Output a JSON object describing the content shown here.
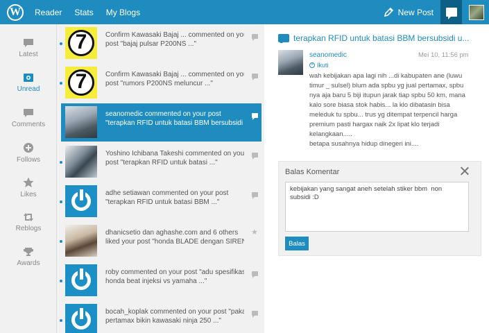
{
  "topbar": {
    "logo": "W",
    "nav": [
      "Reader",
      "Stats",
      "My Blogs"
    ],
    "new_post": "New Post"
  },
  "leftnav": {
    "items": [
      {
        "label": "Latest",
        "icon": "comment-bubble-icon"
      },
      {
        "label": "Unread",
        "icon": "unread-icon",
        "active": true
      },
      {
        "label": "Comments",
        "icon": "comment-bubble-icon"
      },
      {
        "label": "Follows",
        "icon": "plus-circle-icon"
      },
      {
        "label": "Likes",
        "icon": "star-icon"
      },
      {
        "label": "Reblogs",
        "icon": "reblog-icon"
      },
      {
        "label": "Awards",
        "icon": "trophy-icon"
      }
    ]
  },
  "notifications": [
    {
      "line1": "Confirm Kawasaki Bajaj ... commented on your",
      "line2": "post \"bajaj pulsar P200NS ...\"",
      "thumb": "kawasaki-logo"
    },
    {
      "line1": "Confirm Kawasaki Bajaj ... commented on your",
      "line2": "post \"rumors P200NS meluncur ...\"",
      "thumb": "kawasaki-logo"
    },
    {
      "line1": "seanomedic commented on your post",
      "line2": "\"terapkan RFID untuk batasi BBM bersubsidi",
      "thumb": "photo",
      "selected": true
    },
    {
      "line1": "Yoshino Ichibana Takeshi commented on your",
      "line2": "post \"terapkan RFID untuk batasi ...\"",
      "thumb": "photo"
    },
    {
      "line1": "adhe setiawan commented on your post",
      "line2": "\"terapkan RFID untuk batasi BBM ...\"",
      "thumb": "gravatar"
    },
    {
      "line1": "dhanicsetio dan aghashe.com and 6 others",
      "line2": "liked your post \"honda BLADE dengan SIREN",
      "thumb": "photo",
      "star": true
    },
    {
      "line1": "roby commented on your post \"adu spesifikasi",
      "line2": "honda beat injeksi vs yamaha ...\"",
      "thumb": "gravatar"
    },
    {
      "line1": "bocah_koplak commented on your post \"pakai",
      "line2": "pertamax bikin kawasaki ninja 250 ...\"",
      "thumb": "gravatar"
    }
  ],
  "detail": {
    "title": "terapkan RFID untuk batasi BBM bersubsidi u...",
    "author": "seanomedic",
    "follow": "Ikuti",
    "date": "Mei 10, 11:56 pm",
    "body_lines": [
      "wah kebijakan apa lagi nih ...di kabupaten ane (luwu",
      "timur _ sulsel) blum ada spbu yg jual pertamax, spbu",
      "nya aja baru 5 biji itupun jarak tiap spbu 50 km, mana",
      "kalo sore biasa stok habis... la klo dibatasin bisa",
      "meleduk tu spbu... trus yg ditempat terpencil harga",
      "premium pasti hargax naik 2x lipat klo terjadi",
      "kelangkaan.....",
      "betapa susahnya hidup dinegeri ini...."
    ]
  },
  "reply": {
    "title": "Balas Komentar",
    "text": "kebijakan yang sangat aneh setelah stiker bbm  non subsidi :D",
    "button": "Balas"
  }
}
